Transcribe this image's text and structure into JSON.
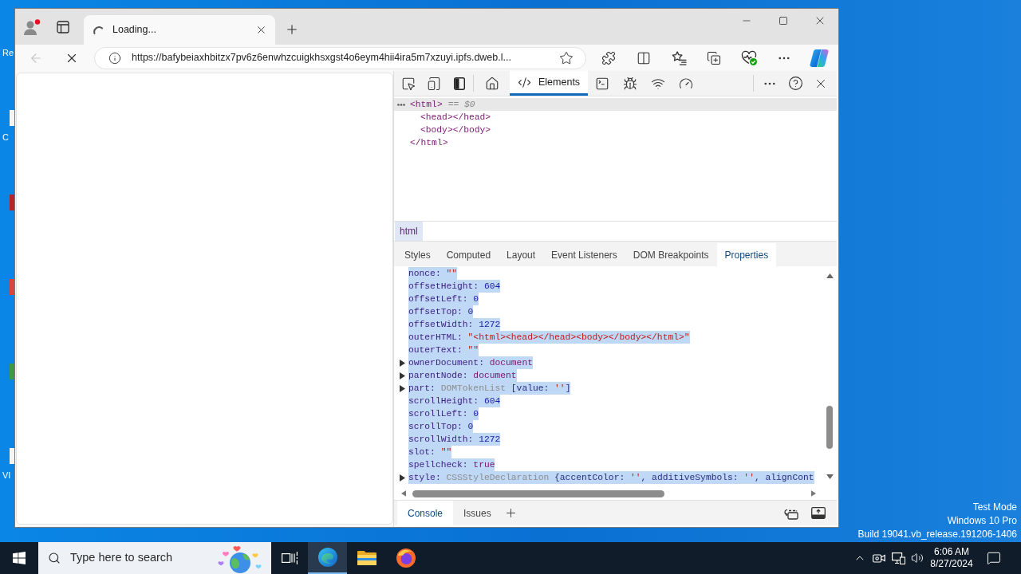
{
  "desktop": {
    "icons": [
      {
        "label": "Re"
      },
      {
        "color": "#f5f5f5",
        "label": "C"
      },
      {
        "color": "#b3262b"
      },
      {
        "color": "#d8473f"
      },
      {
        "color": "#3c9a45"
      },
      {
        "color": "#f5f5f5",
        "label": "VI"
      }
    ],
    "os_notice": [
      "Test Mode",
      "Windows 10 Pro",
      "Build 19041.vb_release.191206-1406"
    ]
  },
  "browser": {
    "tabs": [
      {
        "title": "Loading...",
        "loading": true,
        "selected": true
      }
    ],
    "toolbar": {
      "back_enabled": false,
      "loading": true,
      "url": "https://bafybeiaxhbitzx7pv6z6enwhzcuigkhsxgst4o6eym4hii4ira5m7xzuyi.ipfs.dweb.l..."
    }
  },
  "devtools": {
    "panel_tabs": [
      {
        "kind": "welcome",
        "selected": false
      },
      {
        "kind": "elements",
        "label": "Elements",
        "selected": true
      },
      {
        "kind": "console",
        "selected": false
      },
      {
        "kind": "sources",
        "selected": false
      },
      {
        "kind": "network",
        "selected": false
      },
      {
        "kind": "performance",
        "selected": false
      }
    ],
    "dom_tree": [
      {
        "open": "<html>",
        "marker": "== $0",
        "selected": true,
        "children": [
          {
            "open": "<head></head>",
            "selected": false
          },
          {
            "open": "<body></body>",
            "selected": false
          }
        ],
        "close": "</html>"
      }
    ],
    "breadcrumbs": [
      {
        "label": "html",
        "selected": true
      }
    ],
    "sidebar_tabs": [
      {
        "label": "Styles",
        "selected": false
      },
      {
        "label": "Computed",
        "selected": false
      },
      {
        "label": "Layout",
        "selected": false
      },
      {
        "label": "Event Listeners",
        "selected": false
      },
      {
        "label": "DOM Breakpoints",
        "selected": false
      },
      {
        "label": "Properties",
        "selected": true
      }
    ],
    "properties": [
      {
        "key": "nonce:",
        "expandable": false,
        "selected": true,
        "value": [
          {
            "kind": "string",
            "text": "\"\""
          }
        ]
      },
      {
        "key": "offsetHeight:",
        "expandable": false,
        "selected": true,
        "value": [
          {
            "kind": "number",
            "text": "604"
          }
        ]
      },
      {
        "key": "offsetLeft:",
        "expandable": false,
        "selected": true,
        "value": [
          {
            "kind": "number",
            "text": "0"
          }
        ]
      },
      {
        "key": "offsetTop:",
        "expandable": false,
        "selected": true,
        "value": [
          {
            "kind": "number",
            "text": "0"
          }
        ]
      },
      {
        "key": "offsetWidth:",
        "expandable": false,
        "selected": true,
        "value": [
          {
            "kind": "number",
            "text": "1272"
          }
        ]
      },
      {
        "key": "outerHTML:",
        "expandable": false,
        "selected": true,
        "value": [
          {
            "kind": "string",
            "text": "\"<html><head></head><body></body></html>\""
          }
        ]
      },
      {
        "key": "outerText:",
        "expandable": false,
        "selected": true,
        "value": [
          {
            "kind": "string",
            "text": "\"\""
          }
        ]
      },
      {
        "key": "ownerDocument:",
        "expandable": true,
        "selected": true,
        "value": [
          {
            "kind": "object",
            "text": "document"
          }
        ]
      },
      {
        "key": "parentNode:",
        "expandable": true,
        "selected": true,
        "value": [
          {
            "kind": "object",
            "text": "document"
          }
        ]
      },
      {
        "key": "part:",
        "expandable": true,
        "selected": true,
        "value": [
          {
            "kind": "type",
            "text": "DOMTokenList"
          },
          {
            "kind": "plain",
            "text": " [value: "
          },
          {
            "kind": "string",
            "text": "''"
          },
          {
            "kind": "plain",
            "text": "]"
          }
        ]
      },
      {
        "key": "scrollHeight:",
        "expandable": false,
        "selected": true,
        "value": [
          {
            "kind": "number",
            "text": "604"
          }
        ]
      },
      {
        "key": "scrollLeft:",
        "expandable": false,
        "selected": true,
        "value": [
          {
            "kind": "number",
            "text": "0"
          }
        ]
      },
      {
        "key": "scrollTop:",
        "expandable": false,
        "selected": true,
        "value": [
          {
            "kind": "number",
            "text": "0"
          }
        ]
      },
      {
        "key": "scrollWidth:",
        "expandable": false,
        "selected": true,
        "value": [
          {
            "kind": "number",
            "text": "1272"
          }
        ]
      },
      {
        "key": "slot:",
        "expandable": false,
        "selected": true,
        "value": [
          {
            "kind": "string",
            "text": "\"\""
          }
        ]
      },
      {
        "key": "spellcheck:",
        "expandable": false,
        "selected": true,
        "value": [
          {
            "kind": "keyword",
            "text": "true"
          }
        ]
      },
      {
        "key": "style:",
        "expandable": true,
        "selected": true,
        "value": [
          {
            "kind": "type",
            "text": "CSSStyleDeclaration"
          },
          {
            "kind": "plain",
            "text": " {accentColor: "
          },
          {
            "kind": "string",
            "text": "''"
          },
          {
            "kind": "plain",
            "text": ", additiveSymbols: "
          },
          {
            "kind": "string",
            "text": "''"
          },
          {
            "kind": "plain",
            "text": ", alignCont"
          }
        ]
      }
    ],
    "drawer_tabs": [
      {
        "label": "Console",
        "selected": true
      },
      {
        "label": "Issues",
        "selected": false
      }
    ]
  },
  "taskbar": {
    "search": {
      "placeholder": "Type here to search"
    },
    "apps": [
      {
        "kind": "task_view",
        "active": false
      },
      {
        "kind": "browser",
        "active": true
      },
      {
        "kind": "files",
        "active": false
      },
      {
        "kind": "firefox",
        "active": false
      }
    ],
    "clock": {
      "time": "6:06 AM",
      "date": "8/27/2024"
    }
  }
}
